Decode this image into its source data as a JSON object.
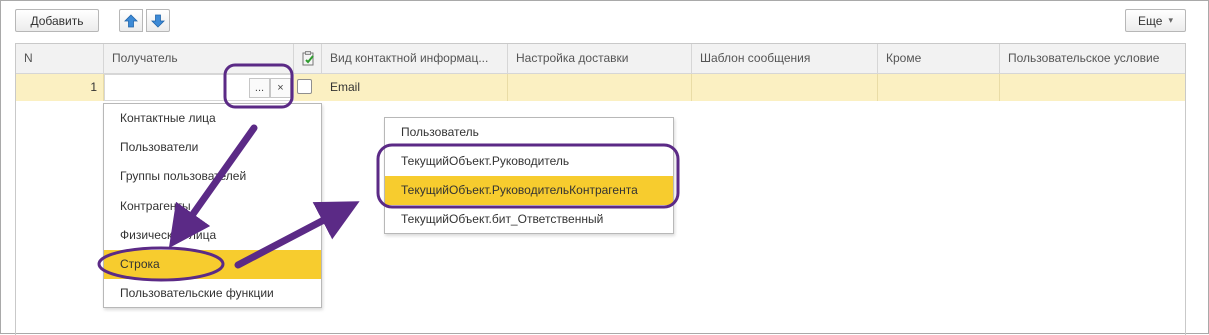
{
  "toolbar": {
    "add_label": "Добавить",
    "up_icon": "arrow-up-icon",
    "down_icon": "arrow-down-icon",
    "more_label": "Еще",
    "more_caret": "▾"
  },
  "table": {
    "headers": [
      "N",
      "Получатель",
      "",
      "Вид контактной информац...",
      "Настройка доставки",
      "Шаблон сообщения",
      "Кроме",
      "Пользовательское условие"
    ],
    "header_icon": "clipboard-check-icon",
    "row": {
      "n": "1",
      "recipient": "",
      "select_button": "...",
      "clear_button": "×",
      "checked": false,
      "contact_type": "Email",
      "delivery": "",
      "template": "",
      "except": "",
      "condition": ""
    }
  },
  "type_menu": {
    "items": [
      "Контактные лица",
      "Пользователи",
      "Группы пользователей",
      "Контрагенты",
      "Физические лица",
      "Строка",
      "Пользовательские функции"
    ],
    "selected_index": 5
  },
  "value_menu": {
    "items": [
      "Пользователь",
      "ТекущийОбъект.Руководитель",
      "ТекущийОбъект.РуководительКонтрагента",
      "ТекущийОбъект.бит_Ответственный"
    ],
    "selected_index": 2
  },
  "annotations": {
    "highlight_color": "#5b2a86",
    "selection_color": "#f7cc2e",
    "row_color": "#fbf0c2"
  }
}
